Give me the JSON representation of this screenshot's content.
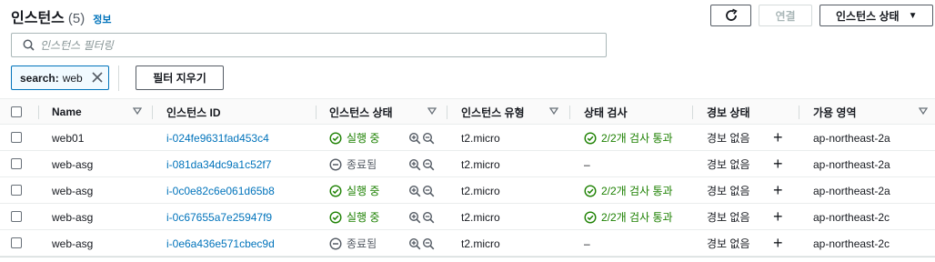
{
  "header": {
    "title": "인스턴스",
    "count": "(5)",
    "info": "정보"
  },
  "toolbar": {
    "connect_label": "연결",
    "state_label": "인스턴스 상태"
  },
  "search": {
    "placeholder": "인스턴스 필터링"
  },
  "filter_token": {
    "key": "search:",
    "value": "web"
  },
  "clear_filters_label": "필터 지우기",
  "columns": {
    "name": "Name",
    "instance_id": "인스턴스 ID",
    "instance_state": "인스턴스 상태",
    "instance_type": "인스턴스 유형",
    "status_check": "상태 검사",
    "alarm_status": "경보 상태",
    "az": "가용 영역"
  },
  "rows": [
    {
      "name": "web01",
      "id": "i-024fe9631fad453c4",
      "state": "실행 중",
      "type": "t2.micro",
      "check": "2/2개 검사 통과",
      "alarm": "경보 없음",
      "az": "ap-northeast-2a"
    },
    {
      "name": "web-asg",
      "id": "i-081da34dc9a1c52f7",
      "state": "종료됨",
      "type": "t2.micro",
      "check": "–",
      "alarm": "경보 없음",
      "az": "ap-northeast-2a"
    },
    {
      "name": "web-asg",
      "id": "i-0c0e82c6e061d65b8",
      "state": "실행 중",
      "type": "t2.micro",
      "check": "2/2개 검사 통과",
      "alarm": "경보 없음",
      "az": "ap-northeast-2a"
    },
    {
      "name": "web-asg",
      "id": "i-0c67655a7e25947f9",
      "state": "실행 중",
      "type": "t2.micro",
      "check": "2/2개 검사 통과",
      "alarm": "경보 없음",
      "az": "ap-northeast-2c"
    },
    {
      "name": "web-asg",
      "id": "i-0e6a436e571cbec9d",
      "state": "종료됨",
      "type": "t2.micro",
      "check": "–",
      "alarm": "경보 없음",
      "az": "ap-northeast-2c"
    }
  ],
  "colors": {
    "link": "#0073bb",
    "success": "#1d8102",
    "muted": "#545b64"
  }
}
